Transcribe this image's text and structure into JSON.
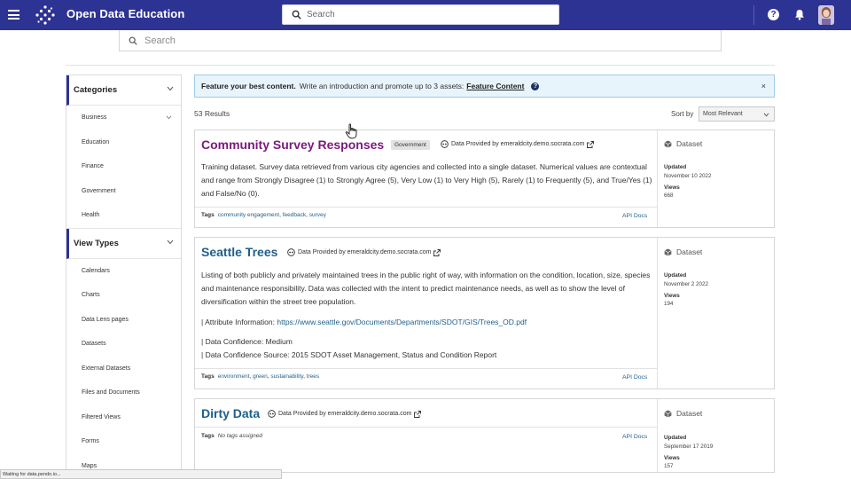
{
  "header": {
    "title": "Open Data Education",
    "search_placeholder": "Search",
    "help_icon": "?"
  },
  "main_search": {
    "placeholder": "Search"
  },
  "sidebar": {
    "categories": {
      "title": "Categories",
      "items": [
        "Business",
        "Education",
        "Finance",
        "Government",
        "Health"
      ]
    },
    "view_types": {
      "title": "View Types",
      "items": [
        "Calendars",
        "Charts",
        "Data Lens pages",
        "Datasets",
        "External Datasets",
        "Files and Documents",
        "Filtered Views",
        "Forms",
        "Maps"
      ]
    }
  },
  "banner": {
    "bold": "Feature your best content.",
    "text": "Write an introduction and promote up to 3 assets:",
    "link": "Feature Content",
    "help": "?",
    "close": "×"
  },
  "results": {
    "count": "53 Results",
    "sort_label": "Sort by",
    "sort_value": "Most Relevant"
  },
  "cards": [
    {
      "title": "Community Survey Responses",
      "badge": "Government",
      "provider": "Data Provided by emeraldcity.demo.socrata.com",
      "description": "Training dataset. Survey data retrieved from various city agencies and collected into a single dataset. Numerical values are contextual and range from Strongly Disagree (1) to Strongly Agree (5), Very Low (1) to Very High (5), Rarely (1) to Frequently (5), and True/Yes (1) and False/No (0).",
      "tags_label": "Tags",
      "tags": [
        "community engagement",
        "feedback",
        "survey"
      ],
      "api_docs": "API Docs",
      "type": "Dataset",
      "updated_label": "Updated",
      "updated": "November 10 2022",
      "views_label": "Views",
      "views": "668"
    },
    {
      "title": "Seattle Trees",
      "provider": "Data Provided by emeraldcity.demo.socrata.com",
      "description": "Listing of both publicly and privately maintained trees in the public right of way, with information on the condition, location, size, species and maintenance responsibility. Data was collected with the intent to predict maintenance needs, as well as to show the level of diversification within the street tree population.",
      "attr_prefix": "| Attribute Information:",
      "attr_link": "https://www.seattle.gov/Documents/Departments/SDOT/GIS/Trees_OD.pdf",
      "confidence": "| Data Confidence: Medium",
      "confidence_source": "| Data Confidence Source: 2015 SDOT Asset Management, Status and Condition Report",
      "tags_label": "Tags",
      "tags": [
        "environment",
        "green",
        "sustainability",
        "trees"
      ],
      "api_docs": "API Docs",
      "type": "Dataset",
      "updated_label": "Updated",
      "updated": "November 2 2022",
      "views_label": "Views",
      "views": "194"
    },
    {
      "title": "Dirty Data",
      "provider": "Data Provided by emeraldcity.demo.socrata.com",
      "tags_label": "Tags",
      "no_tags": "No tags assigned",
      "api_docs": "API Docs",
      "type": "Dataset",
      "updated_label": "Updated",
      "updated": "September 17 2019",
      "views_label": "Views",
      "views": "157"
    }
  ],
  "status_bar": "Waiting for data.pendo.io...",
  "colors": {
    "topbar": "#2d3393",
    "title_purple": "#7a1a7e",
    "title_blue": "#1f5f8b",
    "link": "#1f5f8b"
  }
}
